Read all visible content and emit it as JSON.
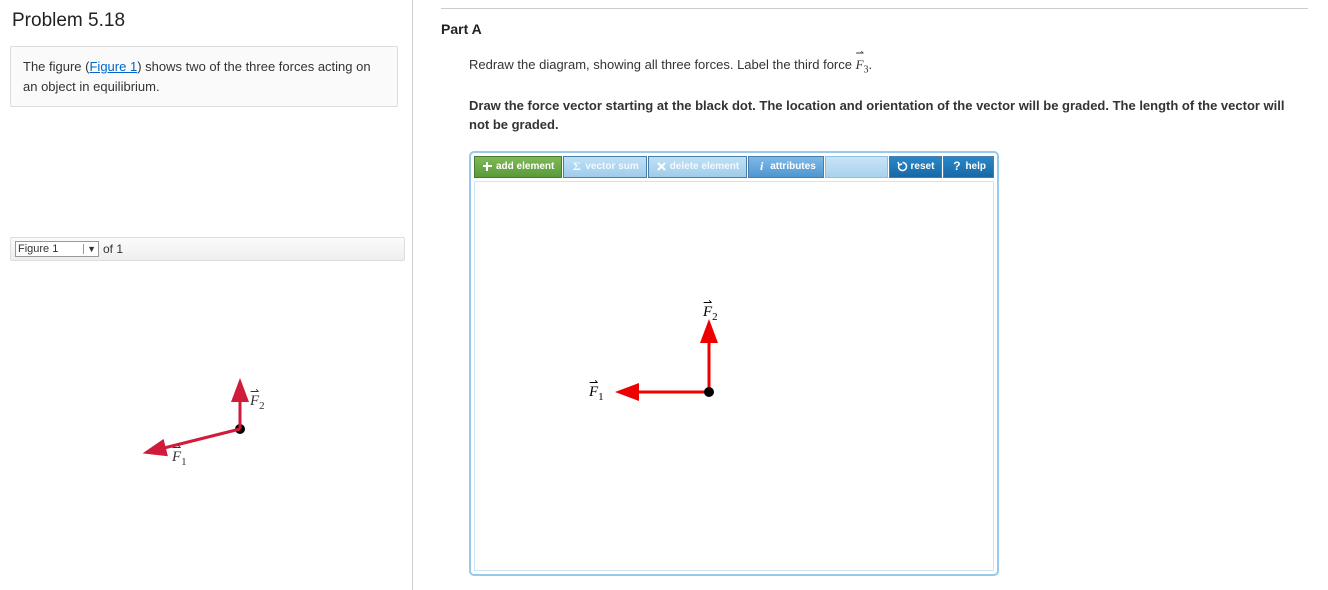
{
  "problem": {
    "title": "Problem 5.18",
    "desc_pre": "The figure (",
    "fig_link": "Figure 1",
    "desc_post": ") shows two of the three forces acting on an object in equilibrium."
  },
  "figure_nav": {
    "selected": "Figure 1",
    "of_label": "of 1"
  },
  "left_figure": {
    "f1_label": "F",
    "f1_sub": "1",
    "f2_label": "F",
    "f2_sub": "2"
  },
  "partA": {
    "title": "Part A",
    "instr_pre": "Redraw the diagram, showing all three forces. Label the third force ",
    "f3_label": "F",
    "f3_sub": "3",
    "instr_post": ".",
    "bold_instr": "Draw the force vector starting at the black dot. The location and orientation of the vector will be graded. The length of the vector will not be graded."
  },
  "toolbar": {
    "add": "add element",
    "sum": "vector sum",
    "del": "delete element",
    "attr": "attributes",
    "reset": "reset",
    "help": "help"
  },
  "canvas": {
    "f1_label": "F",
    "f1_sub": "1",
    "f2_label": "F",
    "f2_sub": "2"
  }
}
